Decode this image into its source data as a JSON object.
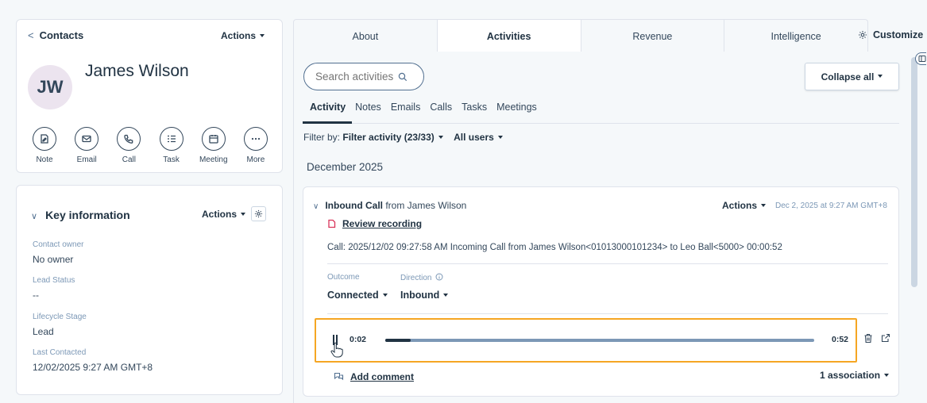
{
  "contact": {
    "back_label": "Contacts",
    "actions_label": "Actions",
    "initials": "JW",
    "name": "James Wilson",
    "quick_actions": [
      {
        "label": "Note",
        "icon": "note-icon"
      },
      {
        "label": "Email",
        "icon": "email-icon"
      },
      {
        "label": "Call",
        "icon": "call-icon"
      },
      {
        "label": "Task",
        "icon": "task-icon"
      },
      {
        "label": "Meeting",
        "icon": "meeting-icon"
      },
      {
        "label": "More",
        "icon": "more-icon"
      }
    ]
  },
  "key_info": {
    "title": "Key information",
    "actions_label": "Actions",
    "properties": [
      {
        "label": "Contact owner",
        "value": "No owner"
      },
      {
        "label": "Lead Status",
        "value": "--"
      },
      {
        "label": "Lifecycle Stage",
        "value": "Lead"
      },
      {
        "label": "Last Contacted",
        "value": "12/02/2025 9:27 AM GMT+8"
      }
    ]
  },
  "tabs": [
    "About",
    "Activities",
    "Revenue",
    "Intelligence"
  ],
  "active_tab": "Activities",
  "customize_label": "Customize",
  "search": {
    "placeholder": "Search activities"
  },
  "collapse_all_label": "Collapse all",
  "subtabs": [
    "Activity",
    "Notes",
    "Emails",
    "Calls",
    "Tasks",
    "Meetings"
  ],
  "filter": {
    "prefix": "Filter by:",
    "activity": "Filter activity (23/33)",
    "users": "All users"
  },
  "month": "December 2025",
  "activity": {
    "type": "Inbound Call",
    "from_text": "from James Wilson",
    "actions_label": "Actions",
    "date": "Dec 2, 2025 at 9:27 AM GMT+8",
    "review_label": "Review recording",
    "description": "Call: 2025/12/02 09:27:58 AM Incoming Call from James Wilson<01013000101234> to Leo Ball<5000> 00:00:52",
    "outcome_label": "Outcome",
    "outcome_value": "Connected",
    "direction_label": "Direction",
    "direction_value": "Inbound",
    "player": {
      "current": "0:02",
      "total": "0:52",
      "progress": 0.06
    },
    "add_comment_label": "Add comment",
    "associations_label": "1 association"
  },
  "colors": {
    "highlight": "#f5a623",
    "text_dark": "#213343",
    "avatar_bg": "#ece4ef"
  }
}
